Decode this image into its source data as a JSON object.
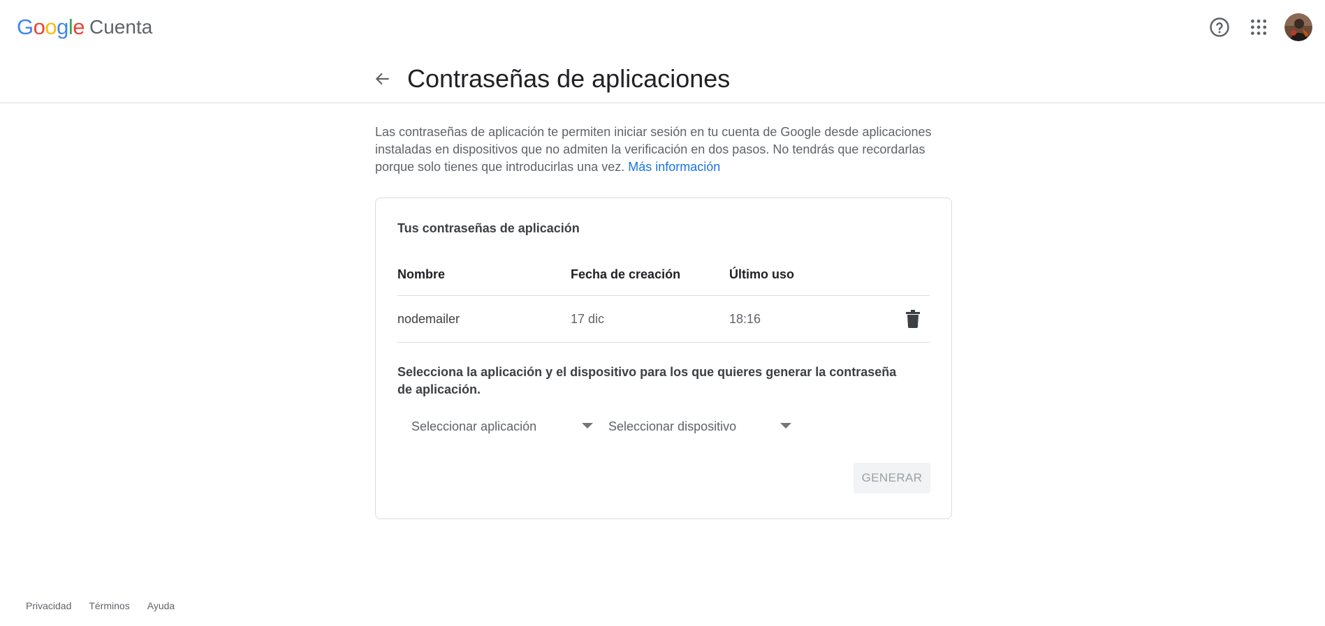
{
  "brand": {
    "logo_letters": [
      "G",
      "o",
      "o",
      "g",
      "l",
      "e"
    ],
    "logo_colors": [
      "#4285F4",
      "#EA4335",
      "#FBBC05",
      "#4285F4",
      "#34A853",
      "#EA4335"
    ],
    "product": "Cuenta"
  },
  "top_actions": {
    "help_icon": "help-circle-icon",
    "apps_icon": "apps-grid-icon",
    "avatar_icon": "user-avatar"
  },
  "header": {
    "back_icon": "arrow-back-icon",
    "title": "Contraseñas de aplicaciones"
  },
  "intro": {
    "text": "Las contraseñas de aplicación te permiten iniciar sesión en tu cuenta de Google desde aplicaciones instaladas en dispositivos que no admiten la verificación en dos pasos. No tendrás que recordarlas porque solo tienes que introducirlas una vez. ",
    "link": "Más información"
  },
  "card": {
    "title": "Tus contraseñas de aplicación",
    "columns": [
      "Nombre",
      "Fecha de creación",
      "Último uso"
    ],
    "rows": [
      {
        "name": "nodemailer",
        "created": "17 dic",
        "last_used": "18:16"
      }
    ],
    "delete_icon": "trash-icon",
    "select_prompt": "Selecciona la aplicación y el dispositivo para los que quieres generar la contraseña de aplicación.",
    "app_select": "Seleccionar aplicación",
    "device_select": "Seleccionar dispositivo",
    "generate_label": "GENERAR"
  },
  "footer": {
    "links": [
      "Privacidad",
      "Términos",
      "Ayuda"
    ]
  },
  "colors": {
    "link": "#1a73e8",
    "text_primary": "#202124",
    "text_secondary": "#5f6368",
    "divider": "#dadce0",
    "disabled_button_bg": "#f1f3f4"
  }
}
